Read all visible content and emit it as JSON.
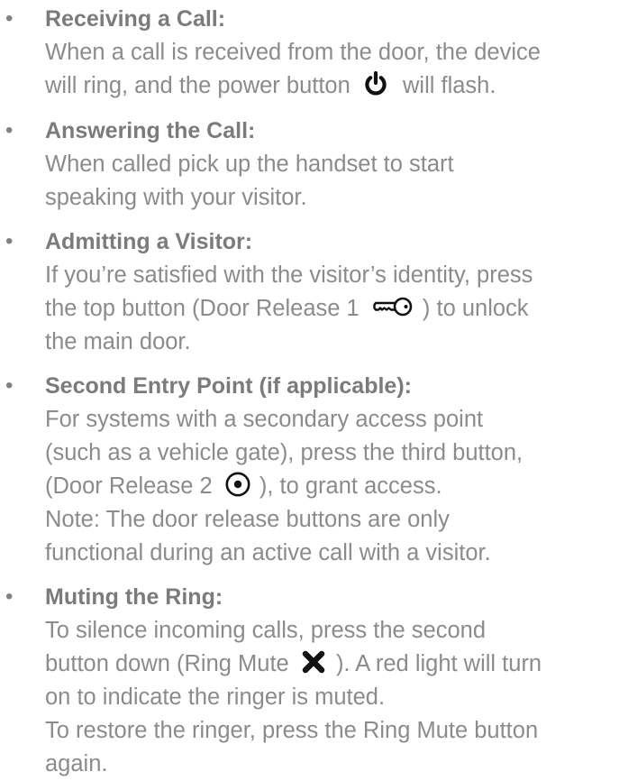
{
  "items": [
    {
      "heading": "Receiving a Call:",
      "line1": "When a call is received from the door, the device",
      "line2a": "will ring, and the power button",
      "line2b": "will flash.",
      "icon": "power-icon"
    },
    {
      "heading": "Answering the Call:",
      "line1": "When called pick up the handset to start",
      "line2": "speaking with your visitor."
    },
    {
      "heading": "Admitting a Visitor:",
      "line1": "If you’re satisfied with the visitor’s identity, press",
      "line2a": "the top button (Door Release 1",
      "line2b": ") to unlock",
      "line3": "the main door.",
      "icon": "key-icon"
    },
    {
      "heading": "Second Entry Point (if applicable):",
      "line1": "For systems with a secondary access point",
      "line2": "(such as a vehicle gate), press the third button,",
      "line3a": "(Door Release 2",
      "line3b": "), to grant access.",
      "line4": "Note: The door release buttons are only",
      "line5": "functional during an active call with a visitor.",
      "icon": "target-icon"
    },
    {
      "heading": "Muting the Ring:",
      "line1": "To silence incoming calls, press the second",
      "line2a": "button down (Ring Mute",
      "line2b": "). A red light will turn",
      "line3": "on to indicate the ringer is muted.",
      "line4": "To restore the ringer, press the Ring Mute button",
      "line5": "again.",
      "icon": "x-icon"
    }
  ],
  "bullet": "•",
  "colors": {
    "heading": "#7b7b7b",
    "body": "#8b8b8b",
    "icon": "#111111"
  }
}
